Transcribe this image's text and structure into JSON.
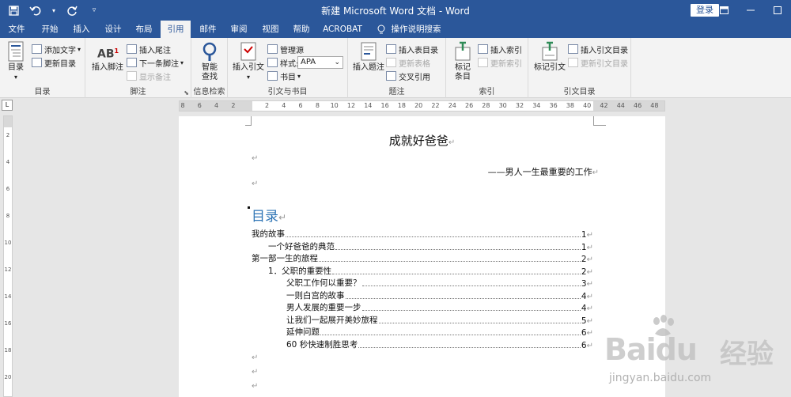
{
  "window": {
    "title": "新建 Microsoft Word 文档 - Word",
    "login_label": "登录"
  },
  "qat": {
    "save_icon": "save-icon",
    "undo_icon": "undo-icon",
    "redo_icon": "redo-icon",
    "customize_icon": "chevron-down-icon"
  },
  "tabs": [
    "文件",
    "开始",
    "插入",
    "设计",
    "布局",
    "引用",
    "邮件",
    "审阅",
    "视图",
    "帮助",
    "ACROBAT",
    "操作说明搜索"
  ],
  "active_tab": "引用",
  "ribbon": {
    "toc_group": {
      "label": "目录",
      "toc_btn": "目录",
      "add_text": "添加文字",
      "update_toc": "更新目录"
    },
    "footnote_group": {
      "label": "脚注",
      "insert_footnote": "插入脚注",
      "insert_endnote": "插入尾注",
      "next_footnote": "下一条脚注",
      "show_notes": "显示备注"
    },
    "research_group": {
      "label": "信息检索",
      "smart_lookup": "智能\n查找"
    },
    "citation_group": {
      "label": "引文与书目",
      "insert_citation": "插入引文",
      "manage_sources": "管理源",
      "style_label": "样式:",
      "style_value": "APA",
      "bibliography": "书目"
    },
    "caption_group": {
      "label": "题注",
      "insert_caption": "插入题注",
      "insert_table_of_figures": "插入表目录",
      "update_table": "更新表格",
      "cross_reference": "交叉引用"
    },
    "index_group": {
      "label": "索引",
      "mark_entry": "标记\n条目",
      "insert_index": "插入索引",
      "update_index": "更新索引"
    },
    "toa_group": {
      "label": "引文目录",
      "mark_citation": "标记引文",
      "insert_toa": "插入引文目录",
      "update_toa": "更新引文目录"
    }
  },
  "ruler": {
    "numbers": [
      "8",
      "6",
      "4",
      "2",
      "",
      "2",
      "4",
      "6",
      "8",
      "10",
      "12",
      "14",
      "16",
      "18",
      "20",
      "22",
      "24",
      "26",
      "28",
      "30",
      "32",
      "34",
      "36",
      "38",
      "40",
      "42",
      "44",
      "46",
      "48"
    ],
    "vnumbers": [
      "2",
      "4",
      "6",
      "8",
      "10",
      "12",
      "14",
      "16",
      "18",
      "20"
    ],
    "corner": "L"
  },
  "document": {
    "title": "成就好爸爸",
    "subtitle": "——男人一生最重要的工作",
    "para_mark": "↵",
    "toc_heading": "目录",
    "toc": [
      {
        "text": "我的故事",
        "page": "1",
        "level": 0
      },
      {
        "text": "一个好爸爸的典范",
        "page": "1",
        "level": 1
      },
      {
        "text": "第一部一生的旅程",
        "page": "2",
        "level": 0
      },
      {
        "text": "1．父职的重要性",
        "page": "2",
        "level": 1
      },
      {
        "text": "父职工作何以重要？",
        "page": "3",
        "level": 2
      },
      {
        "text": "一则白宫的故事",
        "page": "4",
        "level": 2
      },
      {
        "text": "男人发展的重要一步",
        "page": "4",
        "level": 2
      },
      {
        "text": "让我们一起展开美妙旅程",
        "page": "5",
        "level": 2
      },
      {
        "text": "延伸问题",
        "page": "6",
        "level": 2
      },
      {
        "text": "60 秒快速制胜思考",
        "page": "6",
        "level": 2
      }
    ]
  },
  "watermark": {
    "brand": "Bai",
    "brand_tail": "du",
    "cn": "经验",
    "url": "jingyan.baidu.com"
  },
  "colors": {
    "title_bar": "#2b579a",
    "ribbon_bg": "#f3f3f3",
    "toc_heading": "#2e74b5",
    "canvas": "#e6e6e6"
  }
}
